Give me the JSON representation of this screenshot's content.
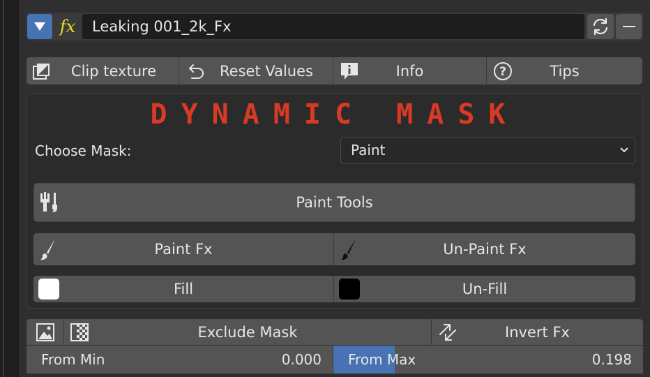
{
  "header": {
    "name": "Leaking 001_2k_Fx",
    "dropdown_icon": "triangle-down-icon",
    "fx_icon_text": "fx",
    "refresh_icon": "refresh-icon",
    "collapse_icon": "minus-icon",
    "accent": "#4772b3"
  },
  "toolbar": {
    "clip_label": "Clip texture",
    "reset_label": "Reset Values",
    "info_label": "Info",
    "tips_label": "Tips"
  },
  "mask": {
    "title": "DYNAMIC MASK",
    "title_color": "#d93a26",
    "choose_label": "Choose Mask:",
    "selected": "Paint"
  },
  "tools": {
    "paint_tools": "Paint Tools",
    "paint_fx": "Paint Fx",
    "unpaint_fx": "Un-Paint Fx",
    "fill": "Fill",
    "unfill": "Un-Fill"
  },
  "bottom": {
    "exclude_mask": "Exclude Mask",
    "invert_fx": "Invert Fx",
    "from_min_label": "From Min",
    "from_min_value": "0.000",
    "from_max_label": "From Max",
    "from_max_value": "0.198",
    "from_max_fraction": 0.198
  }
}
